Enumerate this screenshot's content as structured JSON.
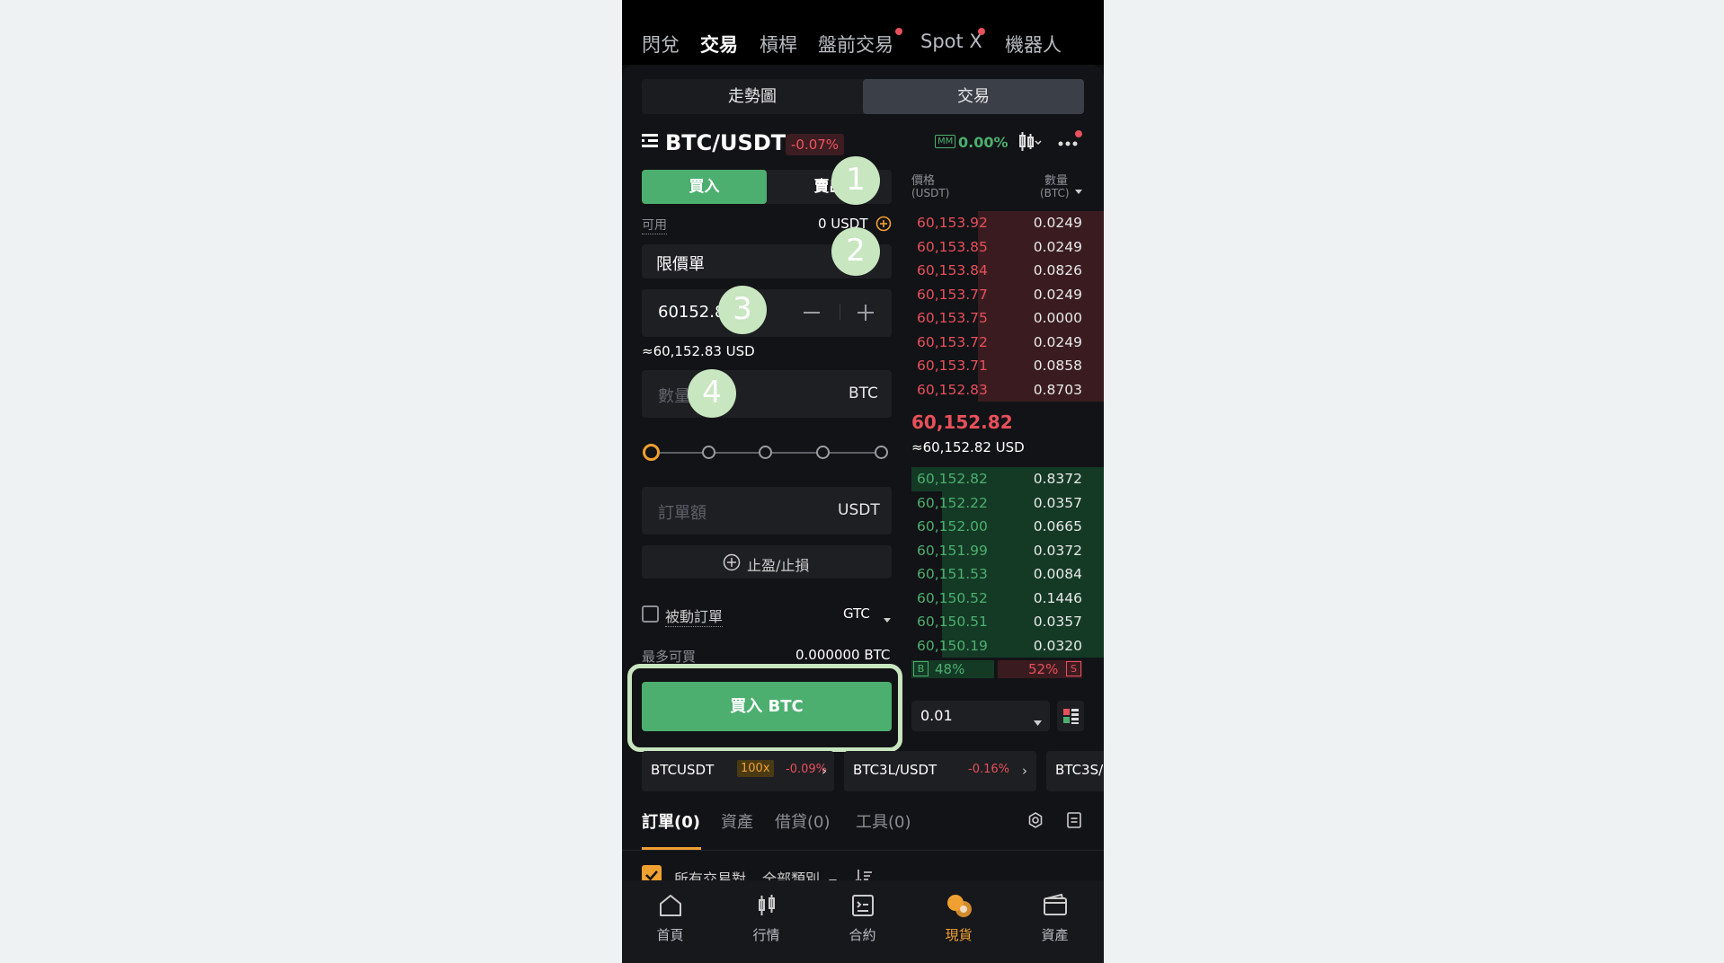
{
  "top_nav": {
    "items": [
      {
        "label": "閃兌"
      },
      {
        "label": "交易"
      },
      {
        "label": "槓桿"
      },
      {
        "label": "盤前交易"
      },
      {
        "label": "Spot X"
      },
      {
        "label": "機器人"
      }
    ],
    "active": "交易"
  },
  "view_tabs": [
    {
      "label": "走勢圖"
    },
    {
      "label": "交易"
    }
  ],
  "pair": {
    "symbol": "BTC/USDT",
    "change": "-0.07%",
    "mm_label": "MM",
    "mm_value": "0.00%"
  },
  "order_form": {
    "buy_label": "買入",
    "sell_label": "賣出",
    "available_label": "可用",
    "available_value": "0 USDT",
    "order_type": "限價單",
    "price_value": "60152.83",
    "price_approx": "≈60,152.83 USD",
    "quantity_placeholder": "數量",
    "quantity_unit": "BTC",
    "amount_placeholder": "訂單額",
    "amount_unit": "USDT",
    "tpsl_label": "止盈/止損",
    "post_only_label": "被動訂單",
    "tif_label": "GTC",
    "max_buy_label": "最多可買",
    "max_buy_value": "0.000000 BTC",
    "submit_label": "買入 BTC",
    "slider_value_percent": 0
  },
  "orderbook": {
    "price_header": "價格",
    "price_unit": "(USDT)",
    "qty_header": "數量",
    "qty_unit": "(BTC)",
    "asks": [
      {
        "price": "60,153.92",
        "qty": "0.0249"
      },
      {
        "price": "60,153.85",
        "qty": "0.0249"
      },
      {
        "price": "60,153.84",
        "qty": "0.0826"
      },
      {
        "price": "60,153.77",
        "qty": "0.0249"
      },
      {
        "price": "60,153.75",
        "qty": "0.0000"
      },
      {
        "price": "60,153.72",
        "qty": "0.0249"
      },
      {
        "price": "60,153.71",
        "qty": "0.0858"
      },
      {
        "price": "60,152.83",
        "qty": "0.8703"
      }
    ],
    "last_price": "60,152.82",
    "last_price_usd": "≈60,152.82 USD",
    "bids": [
      {
        "price": "60,152.82",
        "qty": "0.8372"
      },
      {
        "price": "60,152.22",
        "qty": "0.0357"
      },
      {
        "price": "60,152.00",
        "qty": "0.0665"
      },
      {
        "price": "60,151.99",
        "qty": "0.0372"
      },
      {
        "price": "60,151.53",
        "qty": "0.0084"
      },
      {
        "price": "60,150.52",
        "qty": "0.1446"
      },
      {
        "price": "60,150.51",
        "qty": "0.0357"
      },
      {
        "price": "60,150.19",
        "qty": "0.0320"
      }
    ],
    "buy_ratio_label": "B",
    "buy_ratio": "48%",
    "sell_ratio": "52%",
    "sell_ratio_label": "S",
    "precision": "0.01"
  },
  "related_pairs": [
    {
      "symbol": "BTCUSDT",
      "badge": "100x",
      "change": "-0.09%"
    },
    {
      "symbol": "BTC3L/USDT",
      "badge": "",
      "change": "-0.16%"
    },
    {
      "symbol": "BTC3S/",
      "badge": "",
      "change": ""
    }
  ],
  "order_tabs": [
    {
      "label": "訂單(0)"
    },
    {
      "label": "資產"
    },
    {
      "label": "借貸(0)"
    },
    {
      "label": "工具(0)"
    }
  ],
  "filters": {
    "all_pairs_label": "所有交易對",
    "category_label": "全部類別"
  },
  "bottom_nav": [
    {
      "label": "首頁",
      "icon": "home-icon"
    },
    {
      "label": "行情",
      "icon": "candlestick-icon"
    },
    {
      "label": "合約",
      "icon": "contract-icon"
    },
    {
      "label": "現貨",
      "icon": "spot-icon"
    },
    {
      "label": "資產",
      "icon": "wallet-icon"
    }
  ],
  "annotations": {
    "markers": [
      "1",
      "2",
      "3",
      "4"
    ]
  },
  "colors": {
    "buy_green": "#4caf6f",
    "sell_red": "#e8505b",
    "accent_orange": "#f0a030",
    "highlight_outline": "#c8e6c0"
  }
}
